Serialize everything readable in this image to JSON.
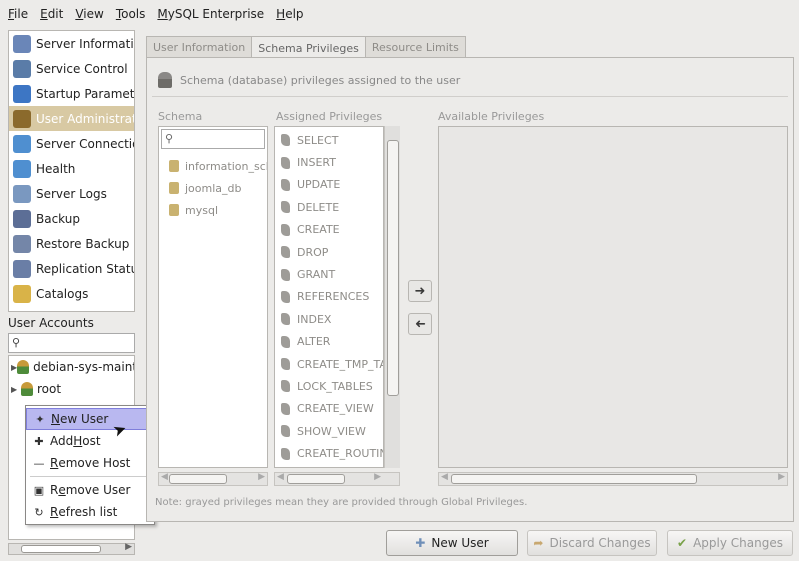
{
  "menubar": [
    {
      "pre": "",
      "key": "F",
      "post": "ile"
    },
    {
      "pre": "",
      "key": "E",
      "post": "dit"
    },
    {
      "pre": "",
      "key": "V",
      "post": "iew"
    },
    {
      "pre": "",
      "key": "T",
      "post": "ools"
    },
    {
      "pre": "",
      "key": "M",
      "post": "ySQL Enterprise"
    },
    {
      "pre": "",
      "key": "H",
      "post": "elp"
    }
  ],
  "sidebar": {
    "items": [
      {
        "label": "Server Information",
        "icon": "server-info-icon",
        "color": "#6a86b8"
      },
      {
        "label": "Service Control",
        "icon": "service-control-icon",
        "color": "#5a7ca8"
      },
      {
        "label": "Startup Parameters",
        "icon": "startup-params-icon",
        "color": "#3d76c4"
      },
      {
        "label": "User Administration",
        "icon": "users-icon",
        "color": "#8b6a2c",
        "selected": true
      },
      {
        "label": "Server Connections",
        "icon": "connections-icon",
        "color": "#4f8fd0"
      },
      {
        "label": "Health",
        "icon": "health-icon",
        "color": "#4f8fd0"
      },
      {
        "label": "Server Logs",
        "icon": "logs-icon",
        "color": "#7a98c0"
      },
      {
        "label": "Backup",
        "icon": "backup-icon",
        "color": "#5c6e96"
      },
      {
        "label": "Restore Backup",
        "icon": "restore-icon",
        "color": "#7486a8"
      },
      {
        "label": "Replication Status",
        "icon": "replication-icon",
        "color": "#6a7ea6"
      },
      {
        "label": "Catalogs",
        "icon": "catalogs-icon",
        "color": "#d9b348"
      }
    ]
  },
  "user_accounts": {
    "label": "User Accounts",
    "users": [
      "debian-sys-maint",
      "root"
    ]
  },
  "context_menu": {
    "items": [
      {
        "pre": "",
        "key": "N",
        "post": "ew User",
        "icon": "✦",
        "name": "new-user-item",
        "highlighted": true
      },
      {
        "pre": "Add ",
        "key": "H",
        "post": "ost",
        "icon": "✚",
        "name": "add-host-item"
      },
      {
        "pre": "",
        "key": "R",
        "post": "emove Host",
        "icon": "—",
        "name": "remove-host-item"
      },
      {
        "pre": "R",
        "key": "e",
        "post": "move User",
        "icon": "▣",
        "name": "remove-user-item",
        "sep_before": true
      },
      {
        "pre": "",
        "key": "R",
        "post": "efresh list",
        "icon": "↻",
        "name": "refresh-list-item"
      }
    ]
  },
  "tabs": [
    {
      "label": "User Information",
      "active": false
    },
    {
      "label": "Schema Privileges",
      "active": true
    },
    {
      "label": "Resource Limits",
      "active": false
    }
  ],
  "panel": {
    "header": "Schema (database) privileges assigned to the user",
    "schema_label": "Schema",
    "assigned_label": "Assigned Privileges",
    "available_label": "Available Privileges",
    "schemas": [
      "information_schema",
      "joomla_db",
      "mysql"
    ],
    "privileges": [
      "SELECT",
      "INSERT",
      "UPDATE",
      "DELETE",
      "CREATE",
      "DROP",
      "GRANT",
      "REFERENCES",
      "INDEX",
      "ALTER",
      "CREATE_TMP_TABLE",
      "LOCK_TABLES",
      "CREATE_VIEW",
      "SHOW_VIEW",
      "CREATE_ROUTINE"
    ],
    "note": "Note: grayed privileges mean they are provided through Global Privileges."
  },
  "buttons": {
    "new_user": "New User",
    "discard": "Discard Changes",
    "apply": "Apply Changes"
  },
  "colors": {
    "window_bg": "#ecebe9",
    "selection": "#b9b8f0",
    "selected_sidebar": "#d8c9a3"
  }
}
